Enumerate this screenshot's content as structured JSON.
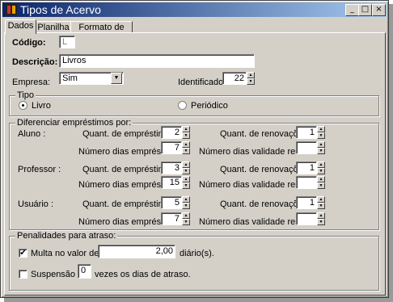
{
  "window": {
    "title": "Tipos de Acervo",
    "controls": {
      "minimize": "_",
      "maximize": "□",
      "close": "×"
    }
  },
  "tabs": [
    "Dados",
    "Planilha",
    "Formato de Saída"
  ],
  "form": {
    "codigo_label": "Código:",
    "codigo_value": "L",
    "descricao_label": "Descrição:",
    "descricao_value": "Livros",
    "empresa_label": "Empresa:",
    "empresa_value": "Sim",
    "identificador_label": "Identificador:",
    "identificador_value": "22"
  },
  "tipo": {
    "title": "Tipo",
    "options": [
      {
        "label": "Livro",
        "selected": true
      },
      {
        "label": "Periódico",
        "selected": false
      }
    ]
  },
  "diferenciar": {
    "title": "Diferenciar empréstimos por:",
    "labels": {
      "quant_emprestimos": "Quant. de empréstimos :",
      "numero_dias_emprestimo": "Número dias empréstimo :",
      "quant_renovacoes": "Quant. de renovações :",
      "numero_dias_validade": "Número dias validade reserva :"
    },
    "rows": [
      {
        "name": "Aluno :",
        "quant_emprestimos": "2",
        "dias_emprestimo": "7",
        "renovacoes": "1",
        "validade": ""
      },
      {
        "name": "Professor :",
        "quant_emprestimos": "3",
        "dias_emprestimo": "15",
        "renovacoes": "1",
        "validade": ""
      },
      {
        "name": "Usuário :",
        "quant_emprestimos": "5",
        "dias_emprestimo": "7",
        "renovacoes": "1",
        "validade": ""
      }
    ]
  },
  "penalidades": {
    "title": "Penalidades para atraso:",
    "multa_label": "Multa no valor de R$",
    "multa_checked": true,
    "multa_value": "2,00",
    "multa_suffix": "diário(s).",
    "suspensao_label": "Suspensão de",
    "suspensao_checked": false,
    "suspensao_value": "0",
    "suspensao_suffix": "vezes os dias de atraso."
  }
}
